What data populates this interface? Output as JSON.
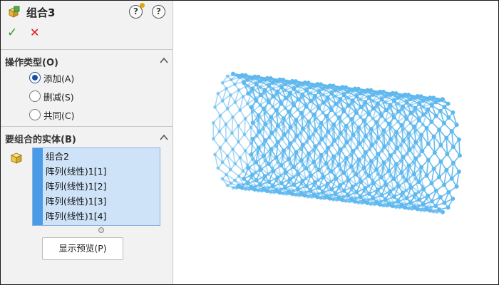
{
  "header": {
    "title": "组合3",
    "help_glyph": "?",
    "help2_glyph": "?"
  },
  "actions": {
    "ok_glyph": "✓",
    "cancel_glyph": "✕"
  },
  "operation_type": {
    "title": "操作类型(O)",
    "options": [
      {
        "label": "添加(A)",
        "selected": true
      },
      {
        "label": "删减(S)",
        "selected": false
      },
      {
        "label": "共同(C)",
        "selected": false
      }
    ]
  },
  "bodies": {
    "title": "要组合的实体(B)",
    "items": [
      "组合2",
      "阵列(线性)1[1]",
      "阵列(线性)1[2]",
      "阵列(线性)1[3]",
      "阵列(线性)1[4]"
    ]
  },
  "preview_button": "显示预览(P)",
  "icons": {
    "feature": "combine-bodies-icon",
    "body": "solid-body-icon",
    "collapse": "chevron-up-icon"
  },
  "colors": {
    "accent": "#1b4f9c",
    "ok": "#2e9a2e",
    "cancel": "#dd1111",
    "list_bg": "#cfe3f8",
    "list_strip": "#4a9ae6",
    "model": "#5fb8ee"
  }
}
